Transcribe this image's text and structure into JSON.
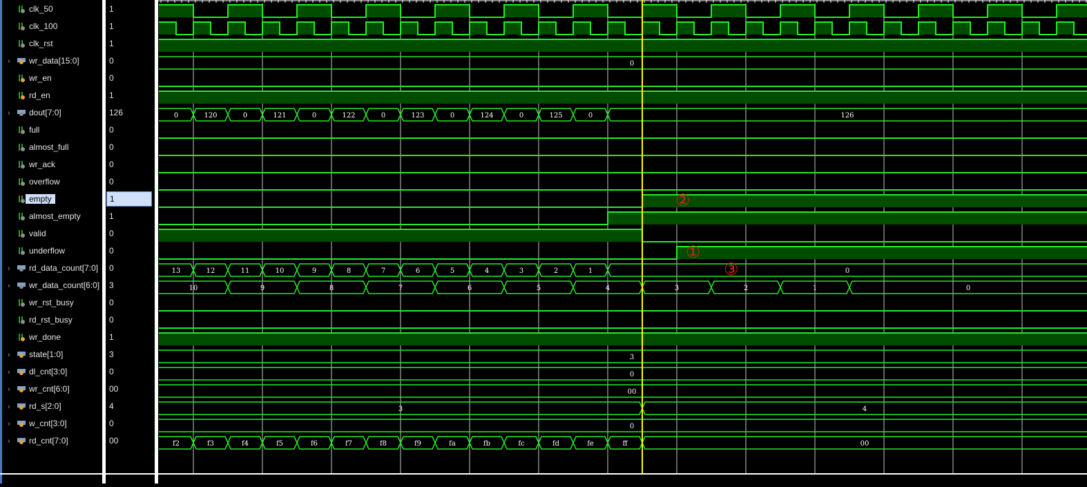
{
  "colors": {
    "wave": "#22ee22",
    "fill": "#004d00",
    "cursor": "#ffff00",
    "grid": "#c8c8c8",
    "text": "#ffffff",
    "annotation": "#e02020",
    "input_icon": "#909090",
    "reg_icon": "#f0a030"
  },
  "time_unit": "ns",
  "time_end": 268,
  "cursor_time": 140,
  "grid": {
    "start": 10,
    "step": 20
  },
  "signals": [
    {
      "name": "clk_50",
      "value": "1",
      "type": "bit",
      "icon": "input",
      "clock": {
        "period": 20
      }
    },
    {
      "name": "clk_100",
      "value": "1",
      "type": "bit",
      "icon": "input",
      "clock": {
        "period": 10
      }
    },
    {
      "name": "clk_rst",
      "value": "1",
      "type": "bit",
      "icon": "input",
      "wave": [
        [
          0,
          1
        ]
      ]
    },
    {
      "name": "wr_data[15:0]",
      "value": "0",
      "type": "bus",
      "icon": "reg",
      "wave": [
        [
          0,
          "0"
        ]
      ]
    },
    {
      "name": "wr_en",
      "value": "0",
      "type": "bit",
      "icon": "reg",
      "wave": [
        [
          0,
          0
        ]
      ]
    },
    {
      "name": "rd_en",
      "value": "1",
      "type": "bit",
      "icon": "reg",
      "wave": [
        [
          0,
          1
        ]
      ]
    },
    {
      "name": "dout[7:0]",
      "value": "126",
      "type": "bus",
      "icon": "input",
      "wave": [
        [
          0,
          "0"
        ],
        [
          10,
          "120"
        ],
        [
          20,
          "0"
        ],
        [
          30,
          "121"
        ],
        [
          40,
          "0"
        ],
        [
          50,
          "122"
        ],
        [
          60,
          "0"
        ],
        [
          70,
          "123"
        ],
        [
          80,
          "0"
        ],
        [
          90,
          "124"
        ],
        [
          100,
          "0"
        ],
        [
          110,
          "125"
        ],
        [
          120,
          "0"
        ],
        [
          130,
          "126"
        ]
      ]
    },
    {
      "name": "full",
      "value": "0",
      "type": "bit",
      "icon": "input",
      "wave": [
        [
          0,
          0
        ]
      ]
    },
    {
      "name": "almost_full",
      "value": "0",
      "type": "bit",
      "icon": "input",
      "wave": [
        [
          0,
          0
        ]
      ]
    },
    {
      "name": "wr_ack",
      "value": "0",
      "type": "bit",
      "icon": "input",
      "wave": [
        [
          0,
          0
        ]
      ]
    },
    {
      "name": "overflow",
      "value": "0",
      "type": "bit",
      "icon": "input",
      "wave": [
        [
          0,
          0
        ]
      ]
    },
    {
      "name": "empty",
      "value": "1",
      "type": "bit",
      "icon": "input",
      "selected": true,
      "wave": [
        [
          0,
          0
        ],
        [
          140,
          1
        ]
      ]
    },
    {
      "name": "almost_empty",
      "value": "1",
      "type": "bit",
      "icon": "input",
      "wave": [
        [
          0,
          0
        ],
        [
          130,
          1
        ]
      ]
    },
    {
      "name": "valid",
      "value": "0",
      "type": "bit",
      "icon": "input",
      "wave": [
        [
          0,
          1
        ],
        [
          140,
          0
        ]
      ]
    },
    {
      "name": "underflow",
      "value": "0",
      "type": "bit",
      "icon": "input",
      "wave": [
        [
          0,
          0
        ],
        [
          150,
          1
        ]
      ]
    },
    {
      "name": "rd_data_count[7:0]",
      "value": "0",
      "type": "bus",
      "icon": "input",
      "wave": [
        [
          0,
          "13"
        ],
        [
          10,
          "12"
        ],
        [
          20,
          "11"
        ],
        [
          30,
          "10"
        ],
        [
          40,
          "9"
        ],
        [
          50,
          "8"
        ],
        [
          60,
          "7"
        ],
        [
          70,
          "6"
        ],
        [
          80,
          "5"
        ],
        [
          90,
          "4"
        ],
        [
          100,
          "3"
        ],
        [
          110,
          "2"
        ],
        [
          120,
          "1"
        ],
        [
          130,
          "0"
        ]
      ]
    },
    {
      "name": "wr_data_count[6:0]",
      "value": "3",
      "type": "bus",
      "icon": "input",
      "wave": [
        [
          0,
          "10"
        ],
        [
          20,
          "9"
        ],
        [
          40,
          "8"
        ],
        [
          60,
          "7"
        ],
        [
          80,
          "6"
        ],
        [
          100,
          "5"
        ],
        [
          120,
          "4"
        ],
        [
          140,
          "3"
        ],
        [
          160,
          "2"
        ],
        [
          180,
          "1"
        ],
        [
          200,
          "0"
        ]
      ]
    },
    {
      "name": "wr_rst_busy",
      "value": "0",
      "type": "bit",
      "icon": "input",
      "wave": [
        [
          0,
          0
        ]
      ]
    },
    {
      "name": "rd_rst_busy",
      "value": "0",
      "type": "bit",
      "icon": "input",
      "wave": [
        [
          0,
          0
        ]
      ]
    },
    {
      "name": "wr_done",
      "value": "1",
      "type": "bit",
      "icon": "reg",
      "wave": [
        [
          0,
          1
        ]
      ]
    },
    {
      "name": "state[1:0]",
      "value": "3",
      "type": "bus",
      "icon": "reg",
      "wave": [
        [
          0,
          "3"
        ]
      ]
    },
    {
      "name": "dl_cnt[3:0]",
      "value": "0",
      "type": "bus",
      "icon": "reg",
      "wave": [
        [
          0,
          "0"
        ]
      ]
    },
    {
      "name": "wr_cnt[6:0]",
      "value": "00",
      "type": "bus",
      "icon": "reg",
      "wave": [
        [
          0,
          "00"
        ]
      ]
    },
    {
      "name": "rd_s[2:0]",
      "value": "4",
      "type": "bus",
      "icon": "reg",
      "wave": [
        [
          0,
          "3"
        ],
        [
          140,
          "4"
        ]
      ]
    },
    {
      "name": "w_cnt[3:0]",
      "value": "0",
      "type": "bus",
      "icon": "reg",
      "wave": [
        [
          0,
          "0"
        ]
      ]
    },
    {
      "name": "rd_cnt[7:0]",
      "value": "00",
      "type": "bus",
      "icon": "reg",
      "wave": [
        [
          0,
          "f2"
        ],
        [
          10,
          "f3"
        ],
        [
          20,
          "f4"
        ],
        [
          30,
          "f5"
        ],
        [
          40,
          "f6"
        ],
        [
          50,
          "f7"
        ],
        [
          60,
          "f8"
        ],
        [
          70,
          "f9"
        ],
        [
          80,
          "fa"
        ],
        [
          90,
          "fb"
        ],
        [
          100,
          "fc"
        ],
        [
          110,
          "fd"
        ],
        [
          120,
          "fe"
        ],
        [
          130,
          "ff"
        ],
        [
          140,
          "00"
        ]
      ]
    }
  ],
  "annotations": [
    {
      "text": "②",
      "signal": "empty",
      "time": 152
    },
    {
      "text": "①",
      "signal": "underflow",
      "time": 155
    },
    {
      "text": "③",
      "signal": "rd_data_count[7:0]",
      "time": 166
    }
  ]
}
